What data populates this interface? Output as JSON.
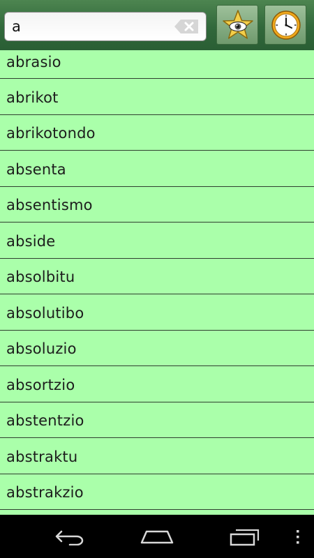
{
  "search": {
    "value": "a"
  },
  "toolbar": {
    "favorites_icon": "star-eye-icon",
    "history_icon": "clock-icon"
  },
  "words": [
    "abrasio",
    "abrikot",
    "abrikotondo",
    "absenta",
    "absentismo",
    "abside",
    "absolbitu",
    "absolutibo",
    "absoluzio",
    "absortzio",
    "abstentzio",
    "abstraktu",
    "abstrakzio"
  ],
  "navbar": {
    "icons": [
      "back-icon",
      "home-icon",
      "recent-apps-icon",
      "overflow-menu-icon"
    ]
  },
  "colors": {
    "list_background": "#aaffaa",
    "header": "#31683b"
  }
}
